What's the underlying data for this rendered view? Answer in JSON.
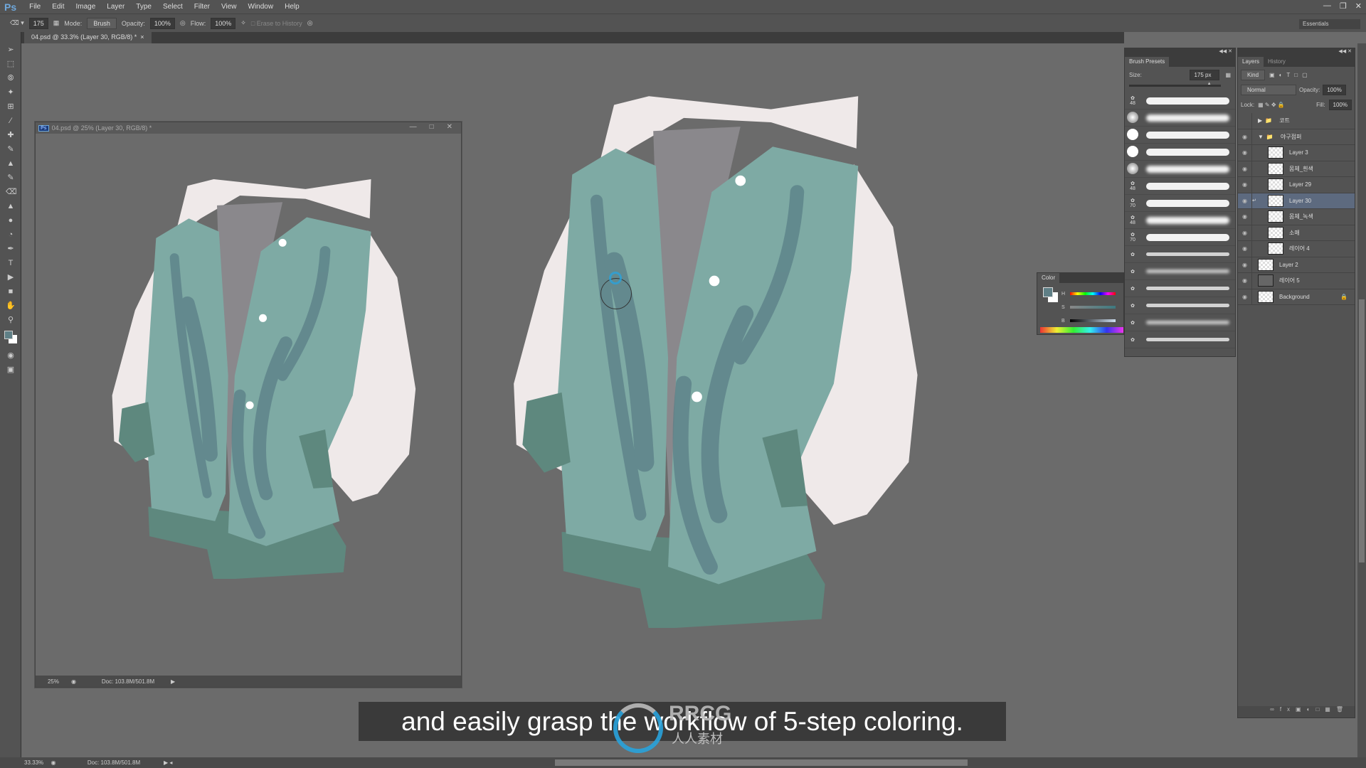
{
  "app": {
    "logo": "Ps"
  },
  "menu": [
    "File",
    "Edit",
    "Image",
    "Layer",
    "Type",
    "Select",
    "Filter",
    "View",
    "Window",
    "Help"
  ],
  "options": {
    "brush_size": "175",
    "mode_label": "Mode:",
    "mode_value": "Brush",
    "opacity_label": "Opacity:",
    "opacity_value": "100%",
    "flow_label": "Flow:",
    "flow_value": "100%",
    "erase_to_history": "Erase to History",
    "workspace": "Essentials"
  },
  "tab": {
    "title": "04.psd @ 33.3% (Layer 30, RGB/8) *",
    "close": "×"
  },
  "floating_doc": {
    "title": "04.psd @ 25% (Layer 30, RGB/8) *",
    "zoom": "25%",
    "doc": "Doc: 103.8M/501.8M"
  },
  "status": {
    "zoom": "33.33%",
    "doc": "Doc: 103.8M/501.8M"
  },
  "brush_presets": {
    "tab": "Brush Presets",
    "size_label": "Size:",
    "size_value": "175 px",
    "sizes": [
      "48",
      "",
      "",
      "",
      "",
      "48",
      "70",
      "48",
      "70",
      "",
      "",
      "",
      "",
      "",
      ""
    ]
  },
  "color_panel": {
    "tab": "Color",
    "labels": [
      "H",
      "S",
      "B"
    ],
    "foreground": "#5f7f86",
    "background": "#ffffff"
  },
  "layers_panel": {
    "tabs": [
      "Layers",
      "History"
    ],
    "filter": "Kind",
    "blend": "Normal",
    "opacity_label": "Opacity:",
    "opacity": "100%",
    "lock_label": "Lock:",
    "fill_label": "Fill:",
    "fill": "100%",
    "layers": [
      {
        "name": "코트",
        "type": "group",
        "collapsed": true,
        "visible": false
      },
      {
        "name": "야구점퍼",
        "type": "group",
        "collapsed": false,
        "visible": true
      },
      {
        "name": "Layer 3",
        "indent": true,
        "visible": true
      },
      {
        "name": "몸체_흰색",
        "indent": true,
        "visible": true
      },
      {
        "name": "Layer 29",
        "indent": true,
        "visible": true
      },
      {
        "name": "Layer 30",
        "indent": true,
        "visible": true,
        "selected": true,
        "clipped": true
      },
      {
        "name": "몸체_녹색",
        "indent": true,
        "visible": true
      },
      {
        "name": "소매",
        "indent": true,
        "visible": true
      },
      {
        "name": "레이어 4",
        "indent": true,
        "visible": true
      },
      {
        "name": "Layer 2",
        "visible": true
      },
      {
        "name": "레이어 5",
        "visible": true
      },
      {
        "name": "Background",
        "visible": true,
        "locked": true
      }
    ]
  },
  "subtitle": "and easily grasp the workflow of 5-step coloring.",
  "watermark": {
    "text": "RRCG",
    "subtext": "人人素材"
  },
  "colors": {
    "jacket_white": "#efe9e9",
    "jacket_teal": "#7eaaa4",
    "jacket_dark": "#5e887e",
    "inner": "#8a888c",
    "canvas": "#6b6b6b",
    "accent": "#29a3dc"
  }
}
